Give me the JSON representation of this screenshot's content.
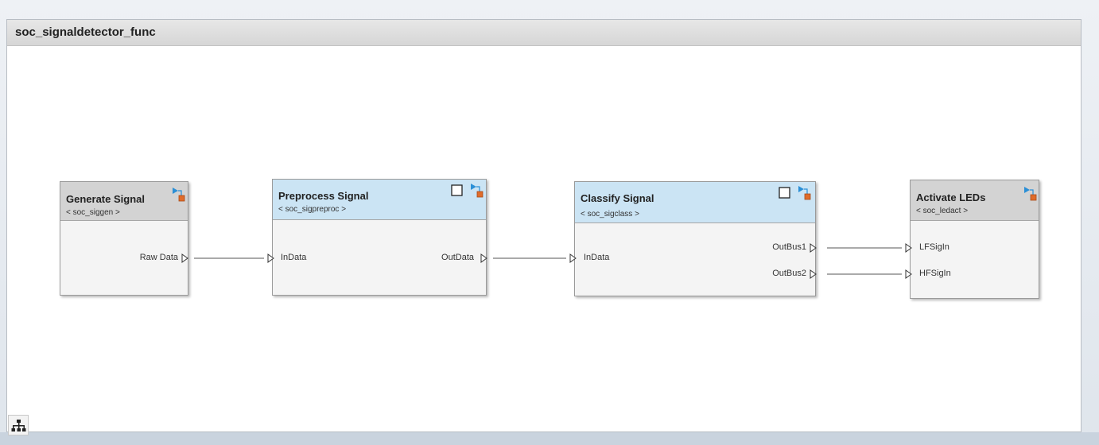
{
  "model": {
    "title": "soc_signaldetector_func"
  },
  "icons": {
    "nav": "hierarchy-icon",
    "reference": "model-reference-icon",
    "subsystem": "subsystem-square-icon",
    "port": "port-arrow-icon"
  },
  "colors": {
    "title_bar": "#d6d6d6",
    "gray_header": "#d3d3d3",
    "blue_header": "#cbe4f4",
    "block_body": "#f4f4f4",
    "ref_badge": "#e06c2a",
    "ref_arrow": "#2b8fd6",
    "wire": "#555555"
  },
  "blocks": [
    {
      "name": "Generate Signal",
      "ref": "< soc_siggen >",
      "ports_out": [
        "Raw Data"
      ],
      "ports_in": []
    },
    {
      "name": "Preprocess Signal",
      "ref": "< soc_sigpreproc >",
      "ports_in": [
        "InData"
      ],
      "ports_out": [
        "OutData"
      ]
    },
    {
      "name": "Classify Signal",
      "ref": "< soc_sigclass >",
      "ports_in": [
        "InData"
      ],
      "ports_out": [
        "OutBus1",
        "OutBus2"
      ]
    },
    {
      "name": "Activate LEDs",
      "ref": "< soc_ledact >",
      "ports_in": [
        "LFSigIn",
        "HFSigIn"
      ],
      "ports_out": []
    }
  ]
}
